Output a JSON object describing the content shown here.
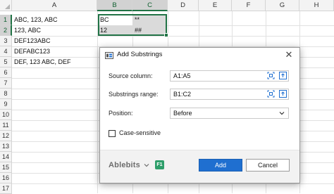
{
  "sheet": {
    "columns": [
      "A",
      "B",
      "C",
      "D",
      "E",
      "F",
      "G",
      "H"
    ],
    "rows": [
      "1",
      "2",
      "3",
      "4",
      "5",
      "6",
      "7",
      "8",
      "9",
      "10",
      "11",
      "12",
      "13",
      "14",
      "15",
      "16",
      "17"
    ],
    "cells": {
      "A1": "ABC, 123, ABC",
      "A2": "123, ABC",
      "A3": "DEF123ABC",
      "A4": "DEFABC123",
      "A5": "DEF, 123 ABC, DEF",
      "B1": "BC",
      "B2": "12",
      "C1": "**",
      "C2": "##"
    },
    "selection": "B1:C2"
  },
  "dialog": {
    "title": "Add Substrings",
    "close_symbol": "✕",
    "source_label": "Source column:",
    "source_value": "A1:A5",
    "substrings_label": "Substrings range:",
    "substrings_value": "B1:C2",
    "position_label": "Position:",
    "position_value": "Before",
    "case_label": "Case-sensitive",
    "case_checked": false,
    "brand": "Ablebits",
    "help_key": "F1",
    "add_label": "Add",
    "cancel_label": "Cancel"
  },
  "colors": {
    "excel_green": "#217346",
    "accent_blue": "#1f6fd0",
    "f1_badge": "#2e9e6a"
  }
}
